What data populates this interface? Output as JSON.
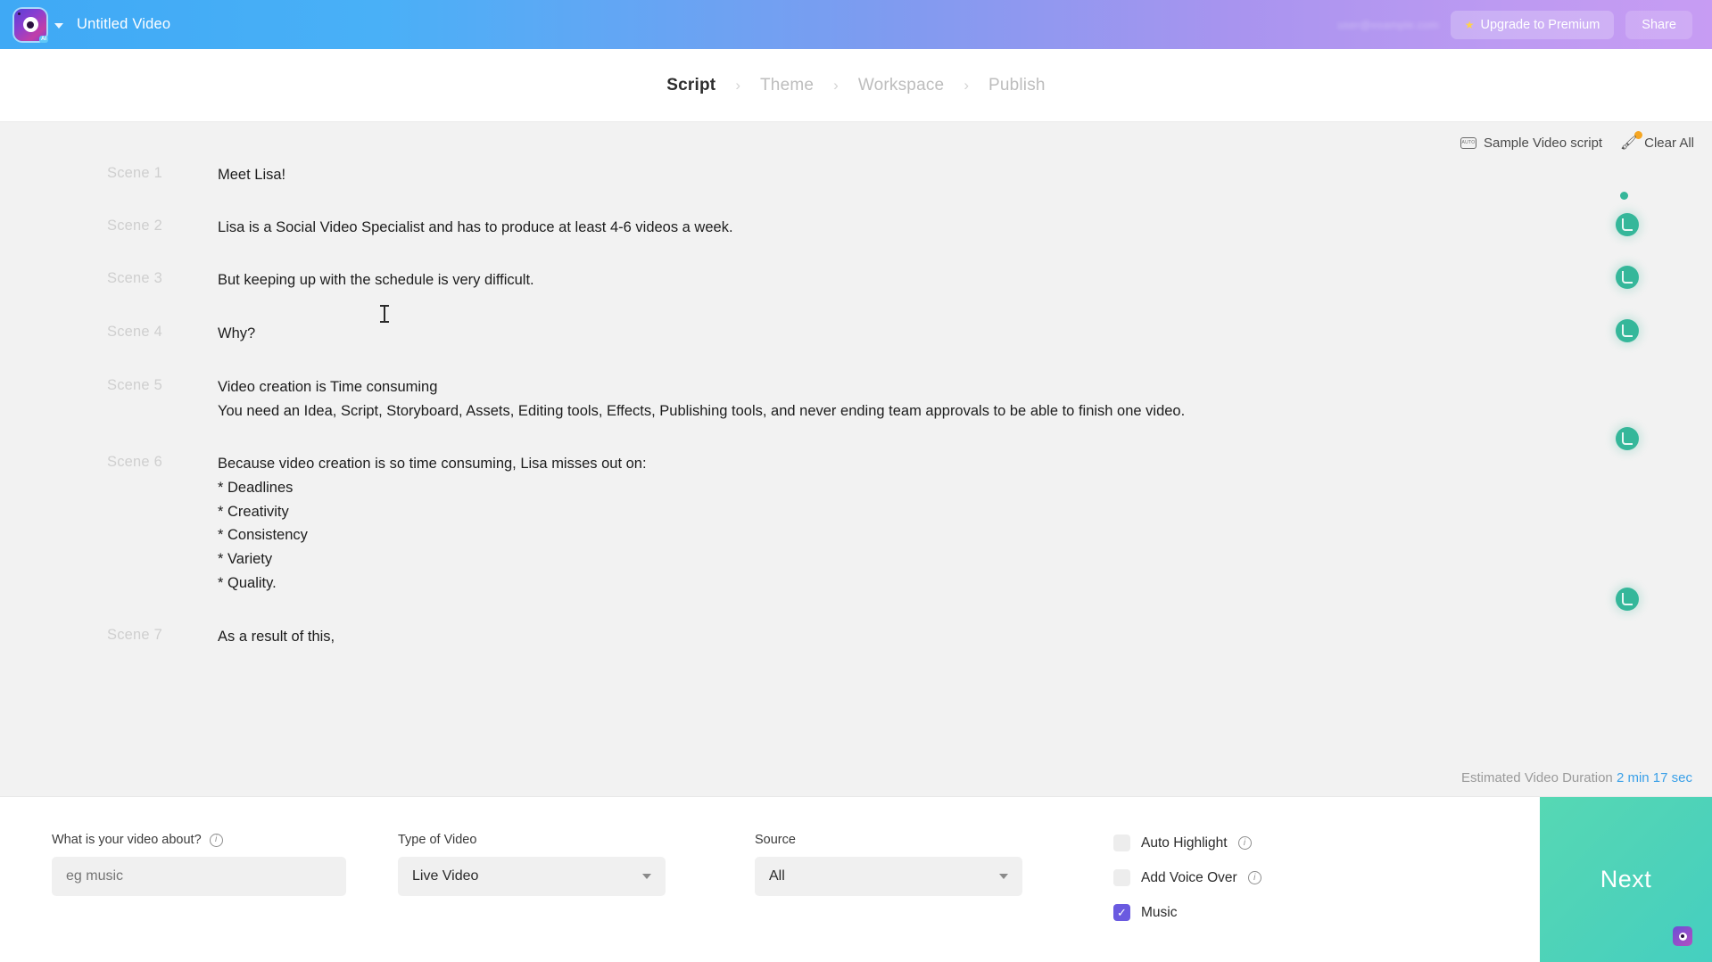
{
  "topbar": {
    "doc_title": "Untitled Video",
    "user_email_blurred": "user@example.com",
    "upgrade_label": "Upgrade to Premium",
    "share_label": "Share",
    "star_icon": "star-icon",
    "logo_badge": "AI"
  },
  "steps": [
    {
      "label": "Script",
      "active": true
    },
    {
      "label": "Theme",
      "active": false
    },
    {
      "label": "Workspace",
      "active": false
    },
    {
      "label": "Publish",
      "active": false
    }
  ],
  "step_separator": "›",
  "script_toolbar": {
    "sample_label": "Sample Video script",
    "sample_icon": "closed-caption-icon",
    "clear_label": "Clear All",
    "clear_icon": "brush-icon"
  },
  "scenes": [
    {
      "label": "Scene 1",
      "text": "Meet Lisa!"
    },
    {
      "label": "Scene 2",
      "text": "Lisa is a Social Video Specialist and has to produce at least 4-6 videos a week."
    },
    {
      "label": "Scene 3",
      "text": "But keeping up with the schedule is very difficult."
    },
    {
      "label": "Scene 4",
      "text": "Why?"
    },
    {
      "label": "Scene 5",
      "text": "Video creation is Time consuming\nYou need an Idea, Script, Storyboard, Assets, Editing tools, Effects, Publishing tools, and never ending team approvals to be able to finish one video."
    },
    {
      "label": "Scene 6",
      "text": "Because video creation is so time consuming, Lisa misses out on:\n* Deadlines\n* Creativity\n* Consistency\n* Variety\n* Quality."
    },
    {
      "label": "Scene 7",
      "text": "As a result of this,"
    }
  ],
  "duration": {
    "label": "Estimated Video Duration",
    "value": "2 min 17 sec"
  },
  "bottombar": {
    "about": {
      "label": "What is your video about?",
      "placeholder": "eg music",
      "value": ""
    },
    "type_of_video": {
      "label": "Type of Video",
      "value": "Live Video"
    },
    "source": {
      "label": "Source",
      "value": "All"
    },
    "checkboxes": [
      {
        "label": "Auto Highlight",
        "checked": false,
        "has_info": true
      },
      {
        "label": "Add Voice Over",
        "checked": false,
        "has_info": true
      },
      {
        "label": "Music",
        "checked": true,
        "has_info": false
      }
    ],
    "checkmark_glyph": "✓",
    "next_label": "Next"
  },
  "colors": {
    "header_start": "#3fa9f5",
    "header_end": "#c79cf3",
    "next_button": "#4fd3b8",
    "voice_dot": "#35b79a",
    "duration_value": "#3aa0e8",
    "checkbox_checked": "#6a5ae0",
    "badge_dot": "#f5a623"
  }
}
